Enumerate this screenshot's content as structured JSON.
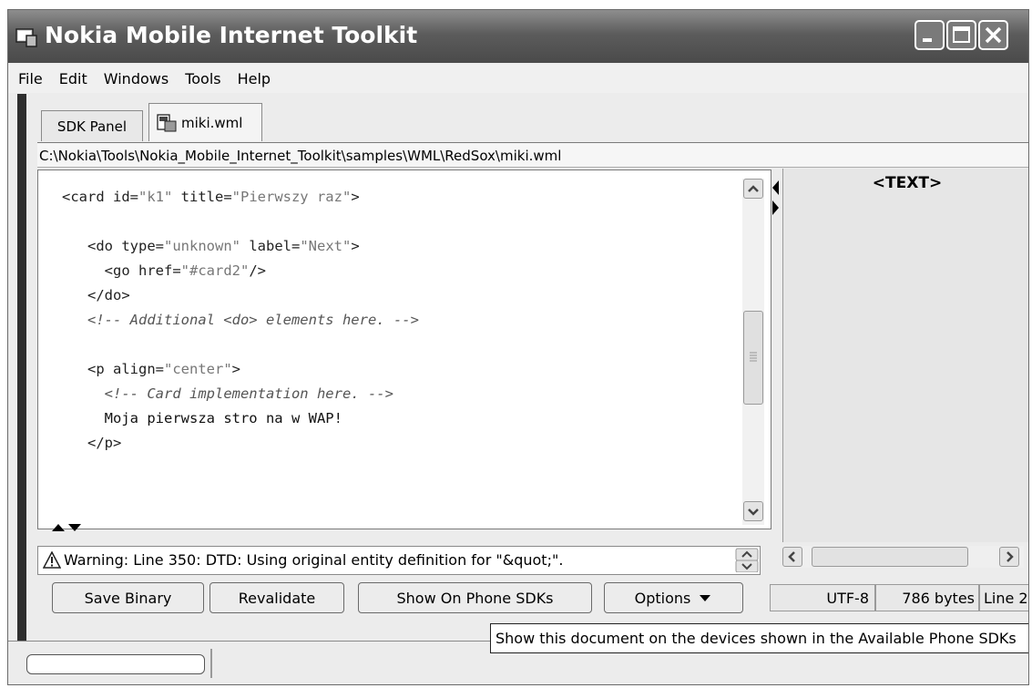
{
  "window": {
    "title": "Nokia Mobile Internet Toolkit"
  },
  "menu": [
    "File",
    "Edit",
    "Windows",
    "Tools",
    "Help"
  ],
  "tabs": [
    {
      "label": "SDK Panel"
    },
    {
      "label": "miki.wml",
      "icon": "document-icon"
    }
  ],
  "path": "C:\\Nokia\\Tools\\Nokia_Mobile_Internet_Toolkit\\samples\\WML\\RedSox\\miki.wml",
  "code": {
    "l1_open": "<card id=",
    "l1_val1": "\"k1\"",
    "l1_mid": " title=",
    "l1_val2": "\"Pierwszy raz\"",
    "l1_close": ">",
    "l2_open": "<do type=",
    "l2_val1": "\"unknown\"",
    "l2_mid": " label=",
    "l2_val2": "\"Next\"",
    "l2_close": ">",
    "l3_open": "<go href=",
    "l3_val": "\"#card2\"",
    "l3_close": "/>",
    "l4": "</do>",
    "l5": "<!-- Additional <do> elements here. -->",
    "l6_open": "<p align=",
    "l6_val": "\"center\"",
    "l6_close": ">",
    "l7": "<!-- Card implementation here. -->",
    "l8": "Moja pierwsza stro na w WAP!",
    "l9": "</p>"
  },
  "preview": {
    "title": "<TEXT>"
  },
  "warning": {
    "text": "Warning: Line 350: DTD: Using original entity definition for \"&quot;\"."
  },
  "buttons": {
    "save_binary": "Save Binary",
    "revalidate": "Revalidate",
    "show_on_phone": "Show On Phone SDKs",
    "options": "Options"
  },
  "status": {
    "encoding": "UTF-8",
    "size": "786 bytes",
    "line": "Line 2"
  },
  "tooltip": "Show this document on the devices shown in the Available Phone SDKs"
}
